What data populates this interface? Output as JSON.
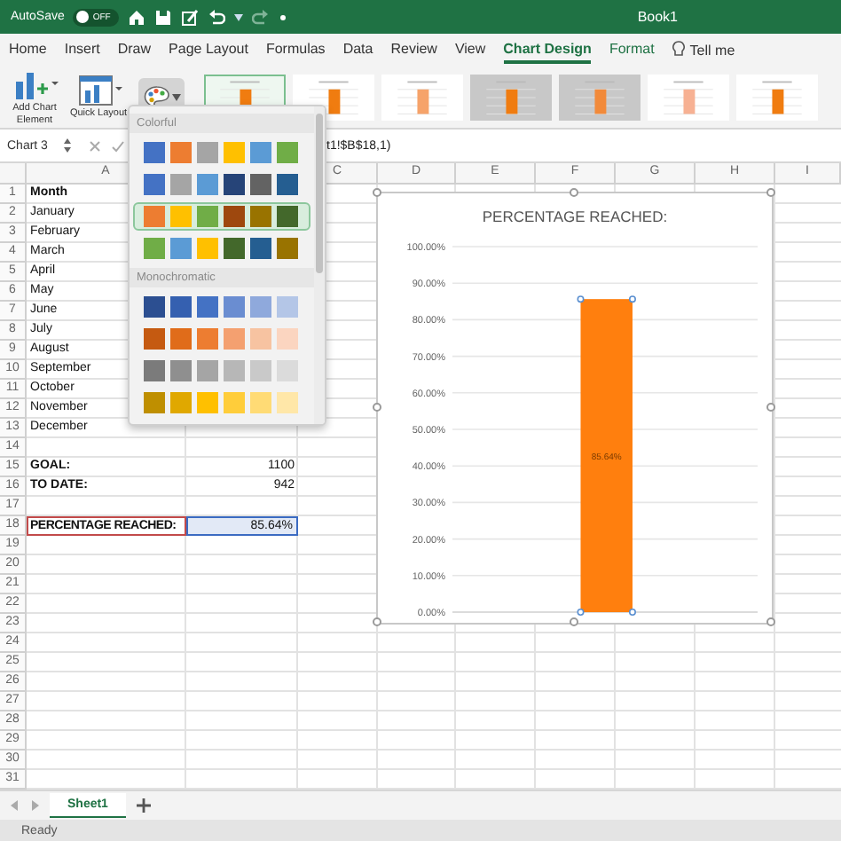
{
  "title_bar": {
    "autosave_label": "AutoSave",
    "autosave_toggle": {
      "label": "OFF",
      "on": false
    },
    "document_title": "Book1"
  },
  "tabs": [
    {
      "label": "Home",
      "selected": false,
      "contextual": false
    },
    {
      "label": "Insert",
      "selected": false,
      "contextual": false
    },
    {
      "label": "Draw",
      "selected": false,
      "contextual": false
    },
    {
      "label": "Page Layout",
      "selected": false,
      "contextual": false
    },
    {
      "label": "Formulas",
      "selected": false,
      "contextual": false
    },
    {
      "label": "Data",
      "selected": false,
      "contextual": false
    },
    {
      "label": "Review",
      "selected": false,
      "contextual": false
    },
    {
      "label": "View",
      "selected": false,
      "contextual": false
    },
    {
      "label": "Chart Design",
      "selected": true,
      "contextual": true
    },
    {
      "label": "Format",
      "selected": false,
      "contextual": true
    }
  ],
  "tell_me": "Tell me",
  "ribbon": {
    "buttons": [
      {
        "label": "Add Chart Element",
        "kind": "add-element"
      },
      {
        "label": "Quick Layout",
        "kind": "layout"
      }
    ],
    "change_colors_pressed": true,
    "chart_styles": [
      {
        "selected": true,
        "kind": "solid"
      },
      {
        "selected": false,
        "kind": "solid"
      },
      {
        "selected": false,
        "kind": "pale"
      },
      {
        "selected": false,
        "kind": "shaded"
      },
      {
        "selected": false,
        "kind": "shaded-pale"
      },
      {
        "selected": false,
        "kind": "peach"
      },
      {
        "selected": false,
        "kind": "solid"
      }
    ]
  },
  "formula_bar": {
    "name_box": "Chart 3",
    "formula": "t1!$B$18,1)"
  },
  "color_menu": {
    "sections": [
      {
        "heading": "Colorful",
        "rows": [
          {
            "selected": false,
            "swatches": [
              {
                "color": "#4472c4"
              },
              {
                "color": "#ed7d31"
              },
              {
                "color": "#a5a5a5"
              },
              {
                "color": "#ffc000"
              },
              {
                "color": "#5b9bd5"
              },
              {
                "color": "#70ad47"
              }
            ]
          },
          {
            "selected": false,
            "swatches": [
              {
                "color": "#4472c4"
              },
              {
                "color": "#a5a5a5"
              },
              {
                "color": "#5b9bd5"
              },
              {
                "color": "#264478"
              },
              {
                "color": "#636363"
              },
              {
                "color": "#255e91"
              }
            ]
          },
          {
            "selected": true,
            "swatches": [
              {
                "color": "#ed7d31"
              },
              {
                "color": "#ffc000"
              },
              {
                "color": "#70ad47"
              },
              {
                "color": "#9e480e"
              },
              {
                "color": "#997300"
              },
              {
                "color": "#43682b"
              }
            ]
          },
          {
            "selected": false,
            "swatches": [
              {
                "color": "#70ad47"
              },
              {
                "color": "#5b9bd5"
              },
              {
                "color": "#ffc000"
              },
              {
                "color": "#43682b"
              },
              {
                "color": "#255e91"
              },
              {
                "color": "#997300"
              }
            ]
          }
        ]
      },
      {
        "heading": "Monochromatic",
        "rows": [
          {
            "selected": false,
            "swatches": [
              {
                "color": "#2c4f91"
              },
              {
                "color": "#3560b0"
              },
              {
                "color": "#4472c4"
              },
              {
                "color": "#6a8dd1"
              },
              {
                "color": "#8fa9dc"
              },
              {
                "color": "#b4c6e7"
              }
            ]
          },
          {
            "selected": false,
            "swatches": [
              {
                "color": "#c55a11"
              },
              {
                "color": "#e06c1a"
              },
              {
                "color": "#ed7d31"
              },
              {
                "color": "#f4a070"
              },
              {
                "color": "#f7c3a1"
              },
              {
                "color": "#fbd5c0"
              }
            ]
          },
          {
            "selected": false,
            "swatches": [
              {
                "color": "#7b7b7b"
              },
              {
                "color": "#8f8f8f"
              },
              {
                "color": "#a5a5a5"
              },
              {
                "color": "#b7b7b7"
              },
              {
                "color": "#c9c9c9"
              },
              {
                "color": "#dbdbdb"
              }
            ]
          },
          {
            "selected": false,
            "swatches": [
              {
                "color": "#bf8f00"
              },
              {
                "color": "#e0a800"
              },
              {
                "color": "#ffc000"
              },
              {
                "color": "#ffcd3a"
              },
              {
                "color": "#ffdb75"
              },
              {
                "color": "#ffe7a8"
              }
            ]
          }
        ]
      }
    ]
  },
  "sheet": {
    "columns": [
      "A",
      "C",
      "D",
      "E",
      "F",
      "G",
      "H",
      "I"
    ],
    "rows": [
      {
        "number": "1",
        "cells": [
          {
            "text": "Month",
            "kind": "text",
            "bold": true,
            "selected": false,
            "outlined": false
          }
        ]
      },
      {
        "number": "2",
        "cells": [
          {
            "text": "January",
            "kind": "text",
            "bold": false,
            "selected": false,
            "outlined": false
          }
        ]
      },
      {
        "number": "3",
        "cells": [
          {
            "text": "February",
            "kind": "text",
            "bold": false,
            "selected": false,
            "outlined": false
          }
        ]
      },
      {
        "number": "4",
        "cells": [
          {
            "text": "March",
            "kind": "text",
            "bold": false,
            "selected": false,
            "outlined": false
          }
        ]
      },
      {
        "number": "5",
        "cells": [
          {
            "text": "April",
            "kind": "text",
            "bold": false,
            "selected": false,
            "outlined": false
          }
        ]
      },
      {
        "number": "6",
        "cells": [
          {
            "text": "May",
            "kind": "text",
            "bold": false,
            "selected": false,
            "outlined": false
          }
        ]
      },
      {
        "number": "7",
        "cells": [
          {
            "text": "June",
            "kind": "text",
            "bold": false,
            "selected": false,
            "outlined": false
          }
        ]
      },
      {
        "number": "8",
        "cells": [
          {
            "text": "July",
            "kind": "text",
            "bold": false,
            "selected": false,
            "outlined": false
          }
        ]
      },
      {
        "number": "9",
        "cells": [
          {
            "text": "August",
            "kind": "text",
            "bold": false,
            "selected": false,
            "outlined": false
          }
        ]
      },
      {
        "number": "10",
        "cells": [
          {
            "text": "September",
            "kind": "text",
            "bold": false,
            "selected": false,
            "outlined": false
          }
        ]
      },
      {
        "number": "11",
        "cells": [
          {
            "text": "October",
            "kind": "text",
            "bold": false,
            "selected": false,
            "outlined": false
          }
        ]
      },
      {
        "number": "12",
        "cells": [
          {
            "text": "November",
            "kind": "text",
            "bold": false,
            "selected": false,
            "outlined": false
          }
        ]
      },
      {
        "number": "13",
        "cells": [
          {
            "text": "December",
            "kind": "text",
            "bold": false,
            "selected": false,
            "outlined": false
          }
        ]
      },
      {
        "number": "14"
      },
      {
        "number": "15",
        "cells": [
          {
            "text": "GOAL:",
            "kind": "text",
            "bold": true,
            "selected": false,
            "outlined": false
          },
          {
            "text": "1100",
            "kind": "number",
            "bold": false,
            "selected": false,
            "outlined": false
          }
        ]
      },
      {
        "number": "16",
        "cells": [
          {
            "text": "TO DATE:",
            "kind": "text",
            "bold": true,
            "selected": false,
            "outlined": false
          },
          {
            "text": "942",
            "kind": "number",
            "bold": false,
            "selected": false,
            "outlined": false
          }
        ]
      },
      {
        "number": "17"
      },
      {
        "number": "18",
        "cells": [
          {
            "text": "PERCENTAGE REACHED:",
            "kind": "text",
            "bold": true,
            "selected": false,
            "outlined": true
          },
          {
            "text": "85.64%",
            "kind": "number",
            "bold": false,
            "selected": true,
            "outlined": false
          }
        ]
      },
      {
        "number": "19"
      },
      {
        "number": "20"
      },
      {
        "number": "21"
      },
      {
        "number": "22"
      },
      {
        "number": "23"
      },
      {
        "number": "24"
      },
      {
        "number": "25"
      },
      {
        "number": "26"
      },
      {
        "number": "27"
      },
      {
        "number": "28"
      },
      {
        "number": "29"
      },
      {
        "number": "30"
      },
      {
        "number": "31"
      }
    ]
  },
  "chart": {
    "chart_data": {
      "type": "bar",
      "title": "PERCENTAGE REACHED:",
      "values": [
        0.8564
      ],
      "ylim": [
        0,
        1
      ],
      "grid": true,
      "yticks": [
        {
          "value": 0,
          "label": "0.00%"
        },
        {
          "value": 0.1,
          "label": "10.00%"
        },
        {
          "value": 0.2,
          "label": "20.00%"
        },
        {
          "value": 0.3,
          "label": "30.00%"
        },
        {
          "value": 0.4,
          "label": "40.00%"
        },
        {
          "value": 0.5,
          "label": "50.00%"
        },
        {
          "value": 0.6,
          "label": "60.00%"
        },
        {
          "value": 0.7,
          "label": "70.00%"
        },
        {
          "value": 0.8,
          "label": "80.00%"
        },
        {
          "value": 0.9,
          "label": "90.00%"
        },
        {
          "value": 1,
          "label": "100.00%"
        }
      ],
      "value_labels": [
        "85.64%"
      ]
    }
  },
  "sheet_tabs": [
    {
      "label": "Sheet1",
      "selected": true
    }
  ],
  "status_bar": "Ready"
}
